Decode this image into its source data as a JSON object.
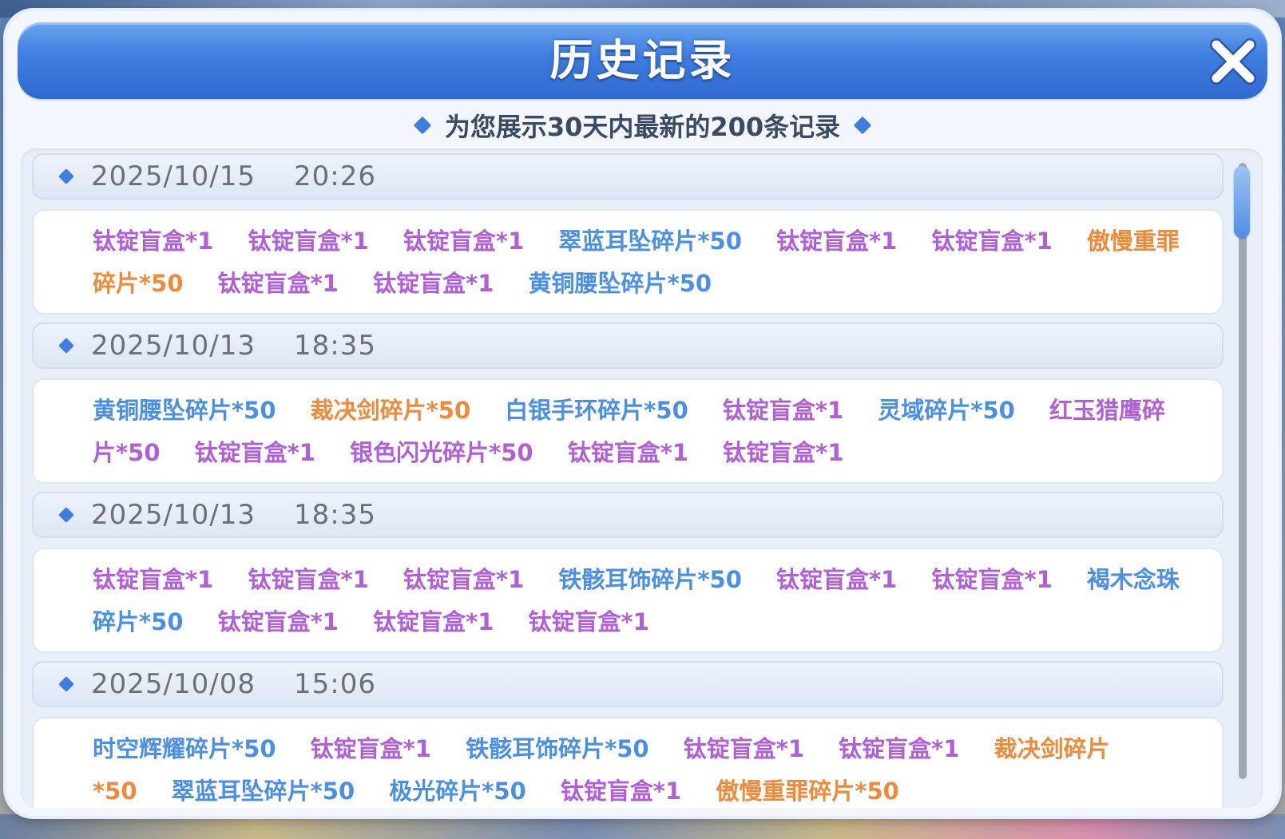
{
  "dialog": {
    "title": "历史记录",
    "subtitle": "为您展示30天内最新的200条记录",
    "close_icon": "close-x-icon"
  },
  "colors": {
    "purple": "#b05fd8",
    "blue": "#4a8fe6",
    "orange": "#ee8a3a",
    "title_bar": "#3f7de0"
  },
  "records": [
    {
      "date": "2025/10/15",
      "time": "20:26",
      "items": [
        {
          "text": "钛锭盲盒*1",
          "color": "purple"
        },
        {
          "text": "钛锭盲盒*1",
          "color": "purple"
        },
        {
          "text": "钛锭盲盒*1",
          "color": "purple"
        },
        {
          "text": "翠蓝耳坠碎片*50",
          "color": "blue"
        },
        {
          "text": "钛锭盲盒*1",
          "color": "purple"
        },
        {
          "text": "钛锭盲盒*1",
          "color": "purple"
        },
        {
          "text": "傲慢重罪碎片*50",
          "color": "orange"
        },
        {
          "text": "钛锭盲盒*1",
          "color": "purple"
        },
        {
          "text": "钛锭盲盒*1",
          "color": "purple"
        },
        {
          "text": "黄铜腰坠碎片*50",
          "color": "blue"
        }
      ]
    },
    {
      "date": "2025/10/13",
      "time": "18:35",
      "items": [
        {
          "text": "黄铜腰坠碎片*50",
          "color": "blue"
        },
        {
          "text": "裁决剑碎片*50",
          "color": "orange"
        },
        {
          "text": "白银手环碎片*50",
          "color": "blue"
        },
        {
          "text": "钛锭盲盒*1",
          "color": "purple"
        },
        {
          "text": "灵域碎片*50",
          "color": "blue"
        },
        {
          "text": "红玉猎鹰碎片*50",
          "color": "purple"
        },
        {
          "text": "钛锭盲盒*1",
          "color": "purple"
        },
        {
          "text": "银色闪光碎片*50",
          "color": "purple"
        },
        {
          "text": "钛锭盲盒*1",
          "color": "purple"
        },
        {
          "text": "钛锭盲盒*1",
          "color": "purple"
        }
      ]
    },
    {
      "date": "2025/10/13",
      "time": "18:35",
      "items": [
        {
          "text": "钛锭盲盒*1",
          "color": "purple"
        },
        {
          "text": "钛锭盲盒*1",
          "color": "purple"
        },
        {
          "text": "钛锭盲盒*1",
          "color": "purple"
        },
        {
          "text": "铁骸耳饰碎片*50",
          "color": "blue"
        },
        {
          "text": "钛锭盲盒*1",
          "color": "purple"
        },
        {
          "text": "钛锭盲盒*1",
          "color": "purple"
        },
        {
          "text": "褐木念珠碎片*50",
          "color": "blue"
        },
        {
          "text": "钛锭盲盒*1",
          "color": "purple"
        },
        {
          "text": "钛锭盲盒*1",
          "color": "purple"
        },
        {
          "text": "钛锭盲盒*1",
          "color": "purple"
        }
      ]
    },
    {
      "date": "2025/10/08",
      "time": "15:06",
      "items": [
        {
          "text": "时空辉耀碎片*50",
          "color": "blue"
        },
        {
          "text": "钛锭盲盒*1",
          "color": "purple"
        },
        {
          "text": "铁骸耳饰碎片*50",
          "color": "blue"
        },
        {
          "text": "钛锭盲盒*1",
          "color": "purple"
        },
        {
          "text": "钛锭盲盒*1",
          "color": "purple"
        },
        {
          "text": "裁决剑碎片*50",
          "color": "orange"
        },
        {
          "text": "翠蓝耳坠碎片*50",
          "color": "blue"
        },
        {
          "text": "极光碎片*50",
          "color": "blue"
        },
        {
          "text": "钛锭盲盒*1",
          "color": "purple"
        },
        {
          "text": "傲慢重罪碎片*50",
          "color": "orange"
        }
      ]
    }
  ]
}
